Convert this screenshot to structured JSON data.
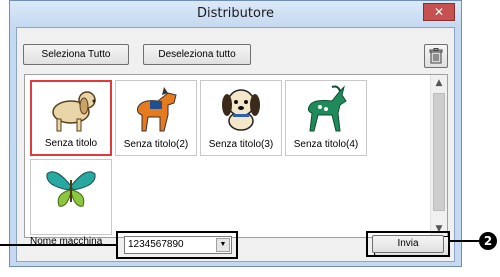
{
  "window": {
    "title": "Distributore",
    "close_symbol": "✕"
  },
  "toolbar": {
    "select_all_label": "Seleziona Tutto",
    "deselect_all_label": "Deseleziona tutto"
  },
  "designs": [
    {
      "label": "Senza titolo",
      "icon": "spaniel-dog-icon",
      "selected": true
    },
    {
      "label": "Senza titolo(2)",
      "icon": "horse-icon",
      "selected": false
    },
    {
      "label": "Senza titolo(3)",
      "icon": "puppy-icon",
      "selected": false
    },
    {
      "label": "Senza titolo(4)",
      "icon": "goat-icon",
      "selected": false
    },
    {
      "label": "",
      "icon": "butterfly-icon",
      "selected": false
    }
  ],
  "scrollbar": {
    "up_symbol": "▲",
    "down_symbol": "▼"
  },
  "machine": {
    "label": "Nome macchina",
    "selected_value": "1234567890"
  },
  "send_button": {
    "label": "Invia"
  },
  "callout": {
    "number": "2"
  },
  "colors": {
    "accent_selected": "#e03a3a",
    "title_bar": "#c5d9f1",
    "close_button": "#c75050"
  }
}
